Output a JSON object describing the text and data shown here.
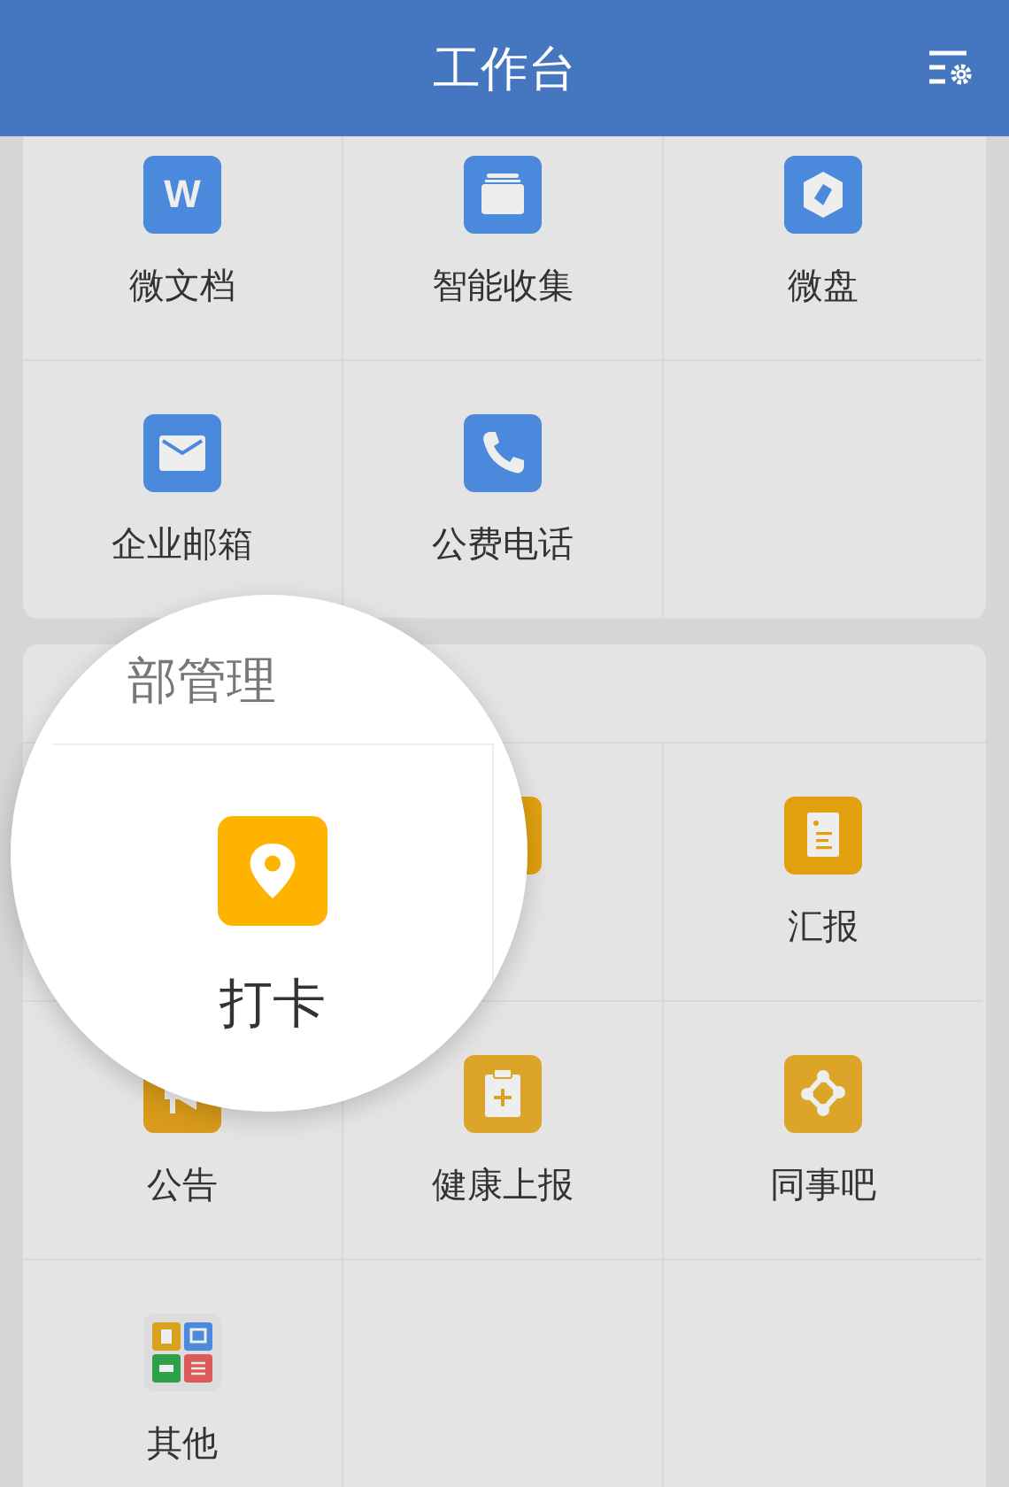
{
  "header": {
    "title": "工作台"
  },
  "sections": [
    {
      "items": [
        {
          "label": "微文档",
          "kind": "letter",
          "glyph": "W",
          "color": "#4a89dc"
        },
        {
          "label": "智能收集",
          "kind": "stack",
          "color": "#4a89dc"
        },
        {
          "label": "微盘",
          "kind": "cube",
          "color": "#4a89dc"
        },
        {
          "label": "企业邮箱",
          "kind": "mail",
          "color": "#4a89dc"
        },
        {
          "label": "公费电话",
          "kind": "phone",
          "color": "#4a89dc"
        }
      ]
    },
    {
      "items": [
        {
          "kind": "covered"
        },
        {
          "kind": "blank",
          "color": "#e0a010"
        },
        {
          "label": "汇报",
          "kind": "report",
          "color": "#e0a010"
        },
        {
          "label": "公告",
          "kind": "megaphone",
          "color": "#d89a1a"
        },
        {
          "label": "健康上报",
          "kind": "clipboard",
          "color": "#dca52a"
        },
        {
          "label": "同事吧",
          "kind": "network",
          "color": "#dca52a"
        },
        {
          "label": "其他",
          "kind": "apps"
        }
      ]
    }
  ],
  "magnifier": {
    "title": "部管理",
    "item": {
      "label": "打卡",
      "kind": "pin",
      "color": "#fdb300"
    }
  }
}
